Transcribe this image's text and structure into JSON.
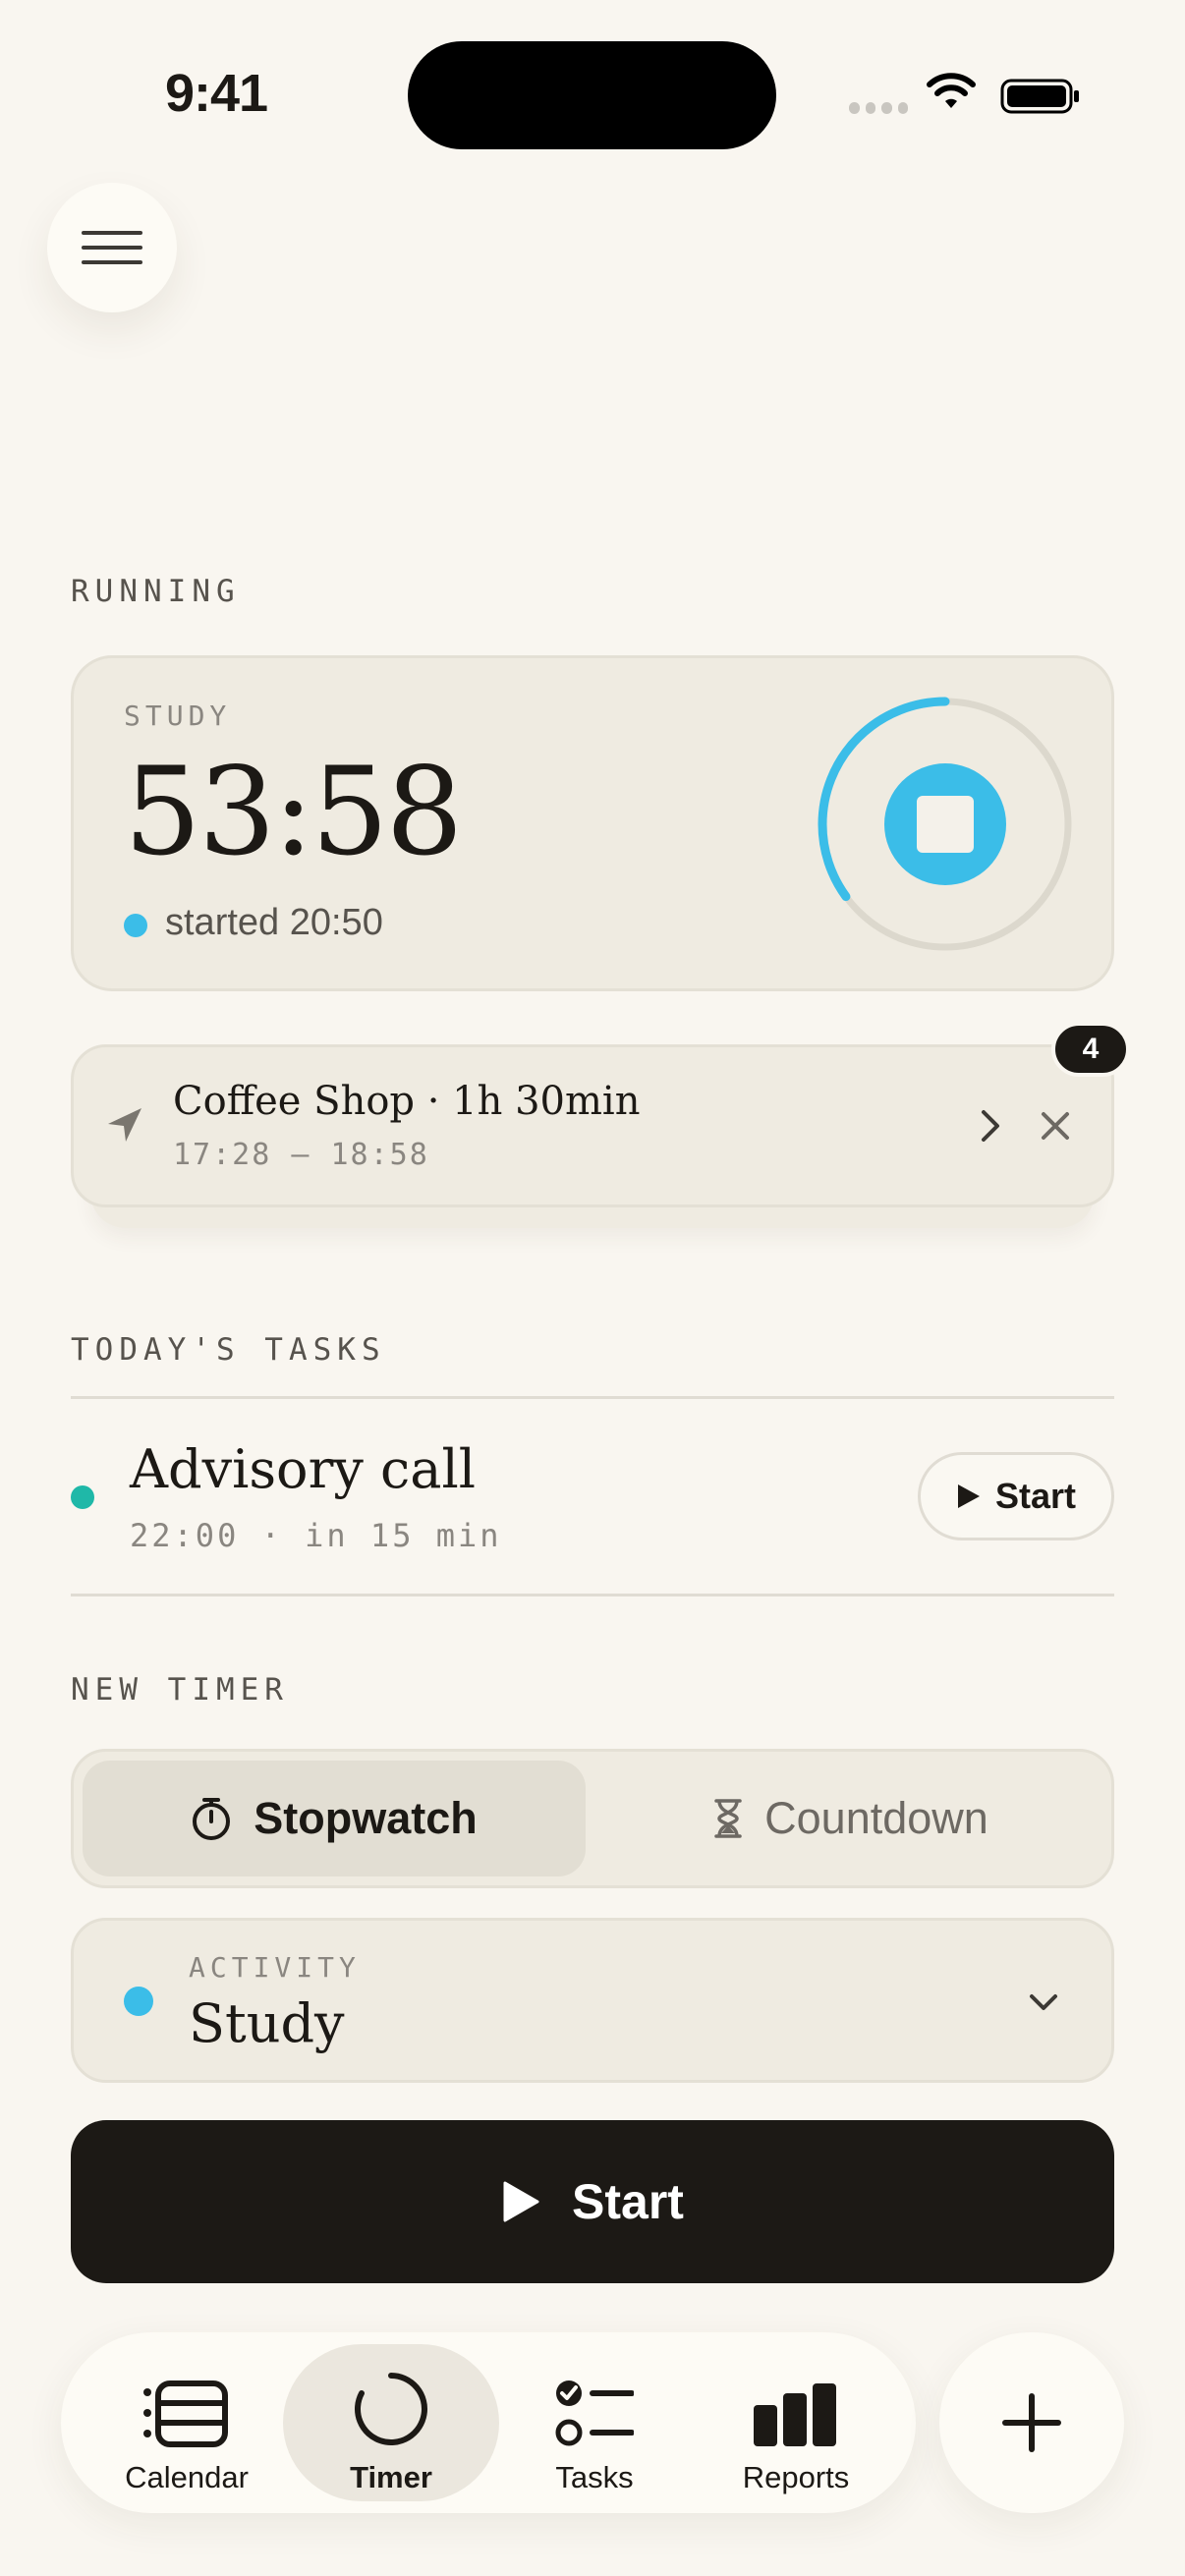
{
  "status_bar": {
    "time": "9:41"
  },
  "running": {
    "section_label": "RUNNING",
    "category": "STUDY",
    "elapsed": "53:58",
    "started": "started 20:50",
    "category_color": "#3bbde8",
    "ring_progress": 0.35
  },
  "suggestion": {
    "title": "Coffee Shop · 1h 30min",
    "time_range": "17:28 — 18:58",
    "badge_count": "4"
  },
  "tasks": {
    "section_label": "TODAY'S TASKS",
    "items": [
      {
        "title": "Advisory call",
        "meta": "22:00 · in 15 min",
        "start_label": "Start",
        "color": "#1fb8a8"
      }
    ]
  },
  "new_timer": {
    "section_label": "NEW TIMER",
    "modes": [
      {
        "label": "Stopwatch",
        "icon": "stopwatch-icon",
        "selected": true
      },
      {
        "label": "Countdown",
        "icon": "hourglass-icon",
        "selected": false
      }
    ],
    "activity": {
      "label": "ACTIVITY",
      "value": "Study",
      "color": "#3bbde8"
    },
    "start_label": "Start"
  },
  "tabbar": {
    "tabs": [
      {
        "label": "Calendar",
        "icon": "calendar-icon"
      },
      {
        "label": "Timer",
        "icon": "timer-icon",
        "active": true
      },
      {
        "label": "Tasks",
        "icon": "tasks-icon"
      },
      {
        "label": "Reports",
        "icon": "reports-icon"
      }
    ],
    "fab_icon": "plus-icon"
  },
  "colors": {
    "background": "#f9f6f0",
    "accent_blue": "#3bbde8",
    "accent_teal": "#1fb8a8",
    "ink": "#1c1915"
  }
}
